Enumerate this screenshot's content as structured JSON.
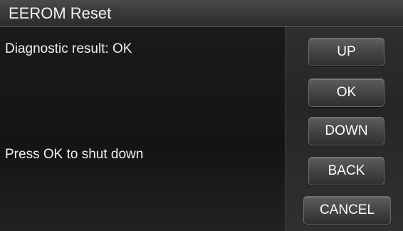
{
  "window": {
    "title": "EEROM Reset"
  },
  "content": {
    "result_text": "Diagnostic result: OK",
    "prompt_text": "Press OK to shut down"
  },
  "buttons": {
    "up": "UP",
    "ok": "OK",
    "down": "DOWN",
    "back": "BACK",
    "cancel": "CANCEL"
  }
}
